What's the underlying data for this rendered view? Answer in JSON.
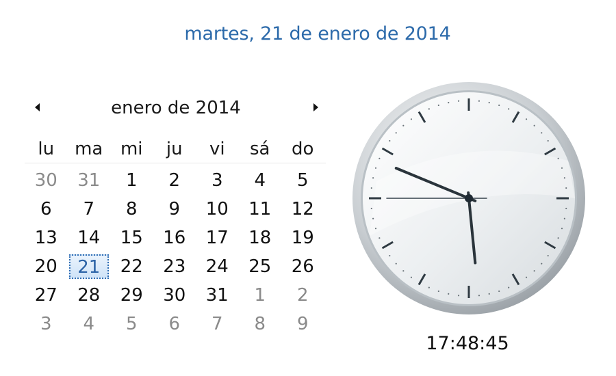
{
  "header": {
    "full_date": "martes, 21 de enero de 2014"
  },
  "calendar": {
    "month_title": "enero de 2014",
    "prev_icon": "triangle-left-icon",
    "next_icon": "triangle-right-icon",
    "weekdays": [
      "lu",
      "ma",
      "mi",
      "ju",
      "vi",
      "sá",
      "do"
    ],
    "weeks": [
      [
        {
          "label": "30",
          "other": true
        },
        {
          "label": "31",
          "other": true
        },
        {
          "label": "1"
        },
        {
          "label": "2"
        },
        {
          "label": "3"
        },
        {
          "label": "4"
        },
        {
          "label": "5"
        }
      ],
      [
        {
          "label": "6"
        },
        {
          "label": "7"
        },
        {
          "label": "8"
        },
        {
          "label": "9"
        },
        {
          "label": "10"
        },
        {
          "label": "11"
        },
        {
          "label": "12"
        }
      ],
      [
        {
          "label": "13"
        },
        {
          "label": "14"
        },
        {
          "label": "15"
        },
        {
          "label": "16"
        },
        {
          "label": "17"
        },
        {
          "label": "18"
        },
        {
          "label": "19"
        }
      ],
      [
        {
          "label": "20"
        },
        {
          "label": "21",
          "today": true
        },
        {
          "label": "22"
        },
        {
          "label": "23"
        },
        {
          "label": "24"
        },
        {
          "label": "25"
        },
        {
          "label": "26"
        }
      ],
      [
        {
          "label": "27"
        },
        {
          "label": "28"
        },
        {
          "label": "29"
        },
        {
          "label": "30"
        },
        {
          "label": "31"
        },
        {
          "label": "1",
          "other": true
        },
        {
          "label": "2",
          "other": true
        }
      ],
      [
        {
          "label": "3",
          "other": true
        },
        {
          "label": "4",
          "other": true
        },
        {
          "label": "5",
          "other": true
        },
        {
          "label": "6",
          "other": true
        },
        {
          "label": "7",
          "other": true
        },
        {
          "label": "8",
          "other": true
        },
        {
          "label": "9",
          "other": true
        }
      ]
    ]
  },
  "clock": {
    "hours": 17,
    "minutes": 48,
    "seconds": 45,
    "time_text": "17:48:45",
    "face_color": "#eef1f3",
    "hand_color": "#1f2a33",
    "accent_color": "#2c6aaa"
  }
}
